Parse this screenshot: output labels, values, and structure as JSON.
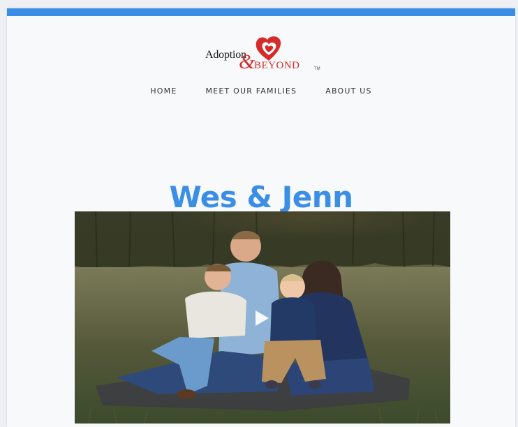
{
  "logo": {
    "word1": "Adoption",
    "amp": "&",
    "word2": "BEYOND",
    "tm": "TM"
  },
  "nav": {
    "items": [
      {
        "label": "HOME"
      },
      {
        "label": "MEET OUR FAMILIES"
      },
      {
        "label": "ABOUT US"
      }
    ]
  },
  "page": {
    "title": "Wes & Jenn"
  },
  "colors": {
    "accent": "#3a8ee6",
    "logo_red": "#d62b2b"
  },
  "video": {
    "play_icon": "play-icon"
  }
}
